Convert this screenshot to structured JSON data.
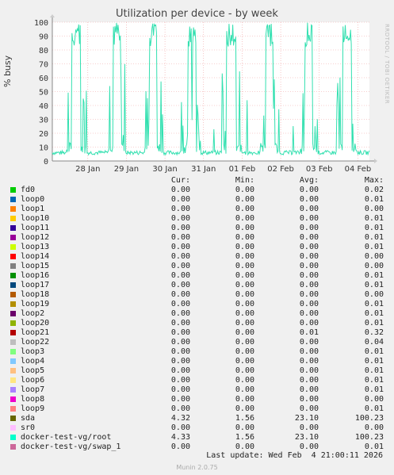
{
  "chart_data": {
    "type": "line",
    "title": "Utilization per device - by week",
    "ylabel": "% busy",
    "ylim": [
      0,
      100
    ],
    "yticks": [
      0,
      10,
      20,
      30,
      40,
      50,
      60,
      70,
      80,
      90,
      100
    ],
    "xticks": [
      "28 Jan",
      "29 Jan",
      "30 Jan",
      "31 Jan",
      "01 Feb",
      "02 Feb",
      "03 Feb",
      "04 Feb"
    ],
    "grid": true,
    "series_color": "#33e0b0",
    "series": [
      {
        "name": "docker-test-vg/root",
        "color": "#33e0b0",
        "peaks": [
          {
            "day": -0.3,
            "width": 0.12,
            "max": 100
          },
          {
            "day": 0.75,
            "width": 0.1,
            "max": 100
          },
          {
            "day": 1.7,
            "width": 0.1,
            "max": 100
          },
          {
            "day": 2.7,
            "width": 0.1,
            "max": 100
          },
          {
            "day": 3.72,
            "width": 0.12,
            "max": 100
          },
          {
            "day": 4.7,
            "width": 0.1,
            "max": 100
          },
          {
            "day": 5.72,
            "width": 0.1,
            "max": 100
          },
          {
            "day": 6.72,
            "width": 0.12,
            "max": 100
          }
        ],
        "baseline": 6
      }
    ]
  },
  "watermark": "RRDTOOL / TOBI OETIKER",
  "legend": {
    "headers": [
      "Cur:",
      "Min:",
      "Avg:",
      "Max:"
    ],
    "rows": [
      {
        "name": "fd0",
        "color": "#00cc00",
        "cur": "0.00",
        "min": "0.00",
        "avg": "0.00",
        "max": "0.02"
      },
      {
        "name": "loop0",
        "color": "#0066b3",
        "cur": "0.00",
        "min": "0.00",
        "avg": "0.00",
        "max": "0.01"
      },
      {
        "name": "loop1",
        "color": "#ff8000",
        "cur": "0.00",
        "min": "0.00",
        "avg": "0.00",
        "max": "0.00"
      },
      {
        "name": "loop10",
        "color": "#ffcc00",
        "cur": "0.00",
        "min": "0.00",
        "avg": "0.00",
        "max": "0.01"
      },
      {
        "name": "loop11",
        "color": "#330099",
        "cur": "0.00",
        "min": "0.00",
        "avg": "0.00",
        "max": "0.01"
      },
      {
        "name": "loop12",
        "color": "#990099",
        "cur": "0.00",
        "min": "0.00",
        "avg": "0.00",
        "max": "0.01"
      },
      {
        "name": "loop13",
        "color": "#ccff00",
        "cur": "0.00",
        "min": "0.00",
        "avg": "0.00",
        "max": "0.01"
      },
      {
        "name": "loop14",
        "color": "#ff0000",
        "cur": "0.00",
        "min": "0.00",
        "avg": "0.00",
        "max": "0.00"
      },
      {
        "name": "loop15",
        "color": "#808080",
        "cur": "0.00",
        "min": "0.00",
        "avg": "0.00",
        "max": "0.00"
      },
      {
        "name": "loop16",
        "color": "#008f00",
        "cur": "0.00",
        "min": "0.00",
        "avg": "0.00",
        "max": "0.01"
      },
      {
        "name": "loop17",
        "color": "#00487d",
        "cur": "0.00",
        "min": "0.00",
        "avg": "0.00",
        "max": "0.01"
      },
      {
        "name": "loop18",
        "color": "#b35a00",
        "cur": "0.00",
        "min": "0.00",
        "avg": "0.00",
        "max": "0.00"
      },
      {
        "name": "loop19",
        "color": "#b38f00",
        "cur": "0.00",
        "min": "0.00",
        "avg": "0.00",
        "max": "0.01"
      },
      {
        "name": "loop2",
        "color": "#6b006b",
        "cur": "0.00",
        "min": "0.00",
        "avg": "0.00",
        "max": "0.01"
      },
      {
        "name": "loop20",
        "color": "#8fb300",
        "cur": "0.00",
        "min": "0.00",
        "avg": "0.00",
        "max": "0.01"
      },
      {
        "name": "loop21",
        "color": "#b30000",
        "cur": "0.00",
        "min": "0.00",
        "avg": "0.01",
        "max": "0.32"
      },
      {
        "name": "loop22",
        "color": "#bebebe",
        "cur": "0.00",
        "min": "0.00",
        "avg": "0.00",
        "max": "0.04"
      },
      {
        "name": "loop3",
        "color": "#80ff80",
        "cur": "0.00",
        "min": "0.00",
        "avg": "0.00",
        "max": "0.01"
      },
      {
        "name": "loop4",
        "color": "#80c9ff",
        "cur": "0.00",
        "min": "0.00",
        "avg": "0.00",
        "max": "0.01"
      },
      {
        "name": "loop5",
        "color": "#ffc080",
        "cur": "0.00",
        "min": "0.00",
        "avg": "0.00",
        "max": "0.01"
      },
      {
        "name": "loop6",
        "color": "#ffe680",
        "cur": "0.00",
        "min": "0.00",
        "avg": "0.00",
        "max": "0.01"
      },
      {
        "name": "loop7",
        "color": "#aa80ff",
        "cur": "0.00",
        "min": "0.00",
        "avg": "0.00",
        "max": "0.01"
      },
      {
        "name": "loop8",
        "color": "#ee00cc",
        "cur": "0.00",
        "min": "0.00",
        "avg": "0.00",
        "max": "0.00"
      },
      {
        "name": "loop9",
        "color": "#ff8080",
        "cur": "0.00",
        "min": "0.00",
        "avg": "0.00",
        "max": "0.01"
      },
      {
        "name": "sda",
        "color": "#666600",
        "cur": "4.32",
        "min": "1.56",
        "avg": "23.10",
        "max": "100.23"
      },
      {
        "name": "sr0",
        "color": "#ffbfff",
        "cur": "0.00",
        "min": "0.00",
        "avg": "0.00",
        "max": "0.00"
      },
      {
        "name": "docker-test-vg/root",
        "color": "#00ffcc",
        "cur": "4.33",
        "min": "1.56",
        "avg": "23.10",
        "max": "100.23"
      },
      {
        "name": "docker-test-vg/swap_1",
        "color": "#cc6699",
        "cur": "0.00",
        "min": "0.00",
        "avg": "0.00",
        "max": "0.01"
      }
    ]
  },
  "footer": {
    "last_update": "Last update: Wed Feb  4 21:00:11 2026",
    "munin": "Munin 2.0.75"
  }
}
